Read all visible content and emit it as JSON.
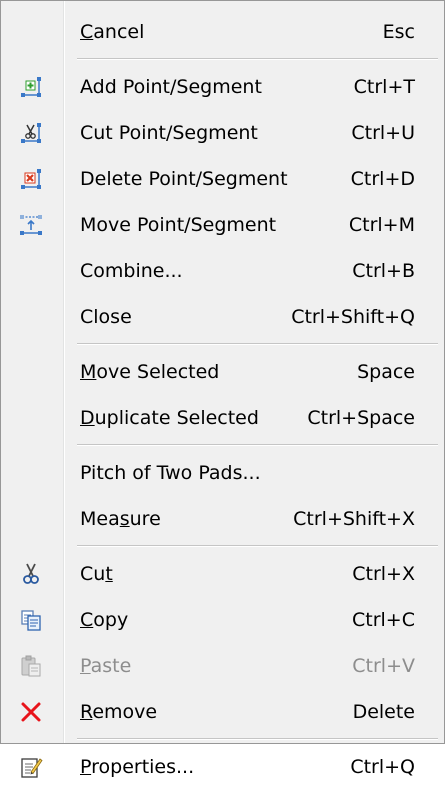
{
  "menu": {
    "cancel": {
      "pre": "",
      "u": "C",
      "post": "ancel",
      "shortcut": "Esc"
    },
    "add_point": {
      "label": "Add Point/Segment",
      "shortcut": "Ctrl+T",
      "icon": "add-point-icon"
    },
    "cut_point": {
      "label": "Cut Point/Segment",
      "shortcut": "Ctrl+U",
      "icon": "cut-point-icon"
    },
    "delete_point": {
      "label": "Delete Point/Segment",
      "shortcut": "Ctrl+D",
      "icon": "delete-point-icon"
    },
    "move_point": {
      "label": "Move Point/Segment",
      "shortcut": "Ctrl+M",
      "icon": "move-point-icon"
    },
    "combine": {
      "label": "Combine...",
      "shortcut": "Ctrl+B"
    },
    "close": {
      "label": "Close",
      "shortcut": "Ctrl+Shift+Q"
    },
    "move_selected": {
      "pre": "",
      "u": "M",
      "post": "ove Selected",
      "shortcut": "Space"
    },
    "duplicate_selected": {
      "pre": "",
      "u": "D",
      "post": "uplicate Selected",
      "shortcut": "Ctrl+Space"
    },
    "pitch": {
      "label": "Pitch of Two Pads...",
      "shortcut": ""
    },
    "measure": {
      "pre": "Mea",
      "u": "s",
      "post": "ure",
      "shortcut": "Ctrl+Shift+X"
    },
    "cut": {
      "pre": "Cu",
      "u": "t",
      "post": "",
      "shortcut": "Ctrl+X",
      "icon": "scissors-icon"
    },
    "copy": {
      "pre": "",
      "u": "C",
      "post": "opy",
      "shortcut": "Ctrl+C",
      "icon": "copy-icon"
    },
    "paste": {
      "pre": "",
      "u": "P",
      "post": "aste",
      "shortcut": "Ctrl+V",
      "icon": "paste-icon",
      "disabled": true
    },
    "remove": {
      "pre": "",
      "u": "R",
      "post": "emove",
      "shortcut": "Delete",
      "icon": "remove-x-icon"
    },
    "properties": {
      "pre": "",
      "u": "P",
      "post": "roperties...",
      "shortcut": "Ctrl+Q",
      "icon": "properties-icon"
    }
  },
  "colors": {
    "add_green": "#2e9e2e",
    "delete_red": "#d83a1e",
    "remove_red": "#e8141b",
    "node_blue": "#3a78c8"
  }
}
